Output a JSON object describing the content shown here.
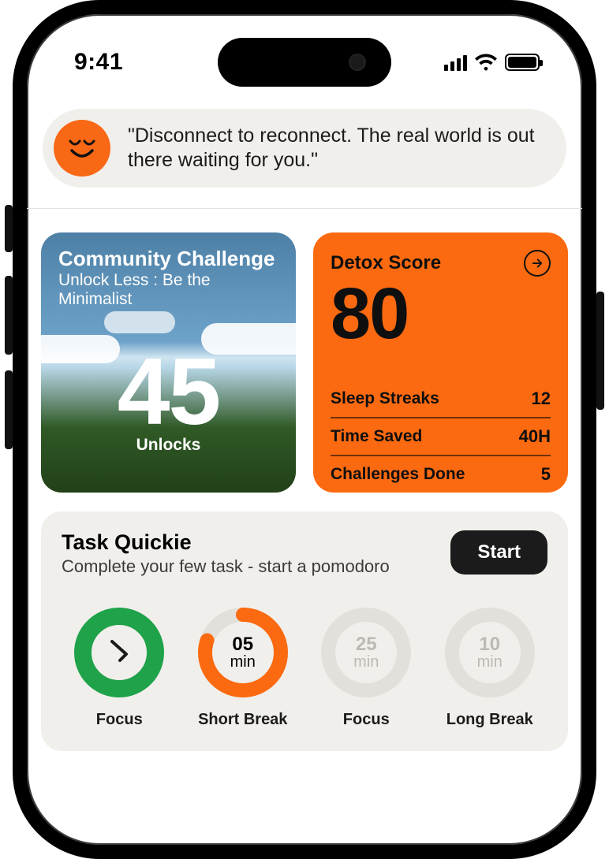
{
  "status": {
    "time": "9:41"
  },
  "quote": {
    "text": "\"Disconnect to reconnect. The real world is out there waiting for you.\""
  },
  "community": {
    "title": "Community Challenge",
    "subtitle": "Unlock Less : Be the Minimalist",
    "value": "45",
    "value_label": "Unlocks"
  },
  "detox": {
    "title": "Detox Score",
    "score": "80",
    "rows": [
      {
        "label": "Sleep Streaks",
        "value": "12"
      },
      {
        "label": "Time Saved",
        "value": "40H"
      },
      {
        "label": "Challenges Done",
        "value": "5"
      }
    ]
  },
  "task": {
    "title": "Task Quickie",
    "subtitle": "Complete your few task - start a pomodoro",
    "start_label": "Start",
    "items": [
      {
        "label": "Focus",
        "time_num": "",
        "time_unit": "",
        "state": "done"
      },
      {
        "label": "Short Break",
        "time_num": "05",
        "time_unit": "min",
        "state": "active"
      },
      {
        "label": "Focus",
        "time_num": "25",
        "time_unit": "min",
        "state": "pending"
      },
      {
        "label": "Long Break",
        "time_num": "10",
        "time_unit": "min",
        "state": "pending"
      }
    ]
  },
  "colors": {
    "accent_orange": "#fb6a10",
    "accent_green": "#1fa24a"
  }
}
